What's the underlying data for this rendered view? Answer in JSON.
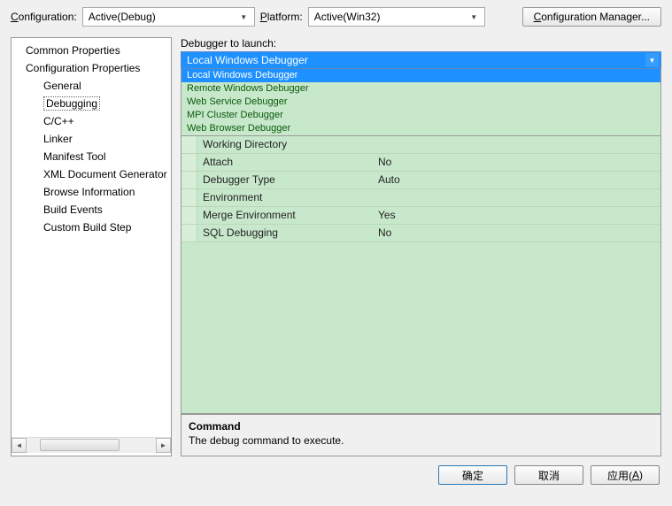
{
  "topbar": {
    "config_label": "Configuration:",
    "config_value": "Active(Debug)",
    "platform_label": "Platform:",
    "platform_value": "Active(Win32)",
    "config_manager": "Configuration Manager..."
  },
  "tree": {
    "items": [
      {
        "label": "Common Properties",
        "level": 0
      },
      {
        "label": "Configuration Properties",
        "level": 0
      },
      {
        "label": "General",
        "level": 1
      },
      {
        "label": "Debugging",
        "level": 1,
        "selected": true
      },
      {
        "label": "C/C++",
        "level": 1
      },
      {
        "label": "Linker",
        "level": 1
      },
      {
        "label": "Manifest Tool",
        "level": 1
      },
      {
        "label": "XML Document Generator",
        "level": 1
      },
      {
        "label": "Browse Information",
        "level": 1
      },
      {
        "label": "Build Events",
        "level": 1
      },
      {
        "label": "Custom Build Step",
        "level": 1
      }
    ]
  },
  "debugger": {
    "launch_label": "Debugger to launch:",
    "selected": "Local Windows Debugger",
    "options": [
      "Local Windows Debugger",
      "Remote Windows Debugger",
      "Web Service Debugger",
      "MPI Cluster Debugger",
      "Web Browser Debugger"
    ]
  },
  "properties": [
    {
      "label": "Working Directory",
      "value": ""
    },
    {
      "label": "Attach",
      "value": "No"
    },
    {
      "label": "Debugger Type",
      "value": "Auto"
    },
    {
      "label": "Environment",
      "value": ""
    },
    {
      "label": "Merge Environment",
      "value": "Yes"
    },
    {
      "label": "SQL Debugging",
      "value": "No"
    }
  ],
  "help": {
    "title": "Command",
    "desc": "The debug command to execute."
  },
  "buttons": {
    "ok": "确定",
    "cancel": "取消",
    "apply": "应用(A)"
  }
}
